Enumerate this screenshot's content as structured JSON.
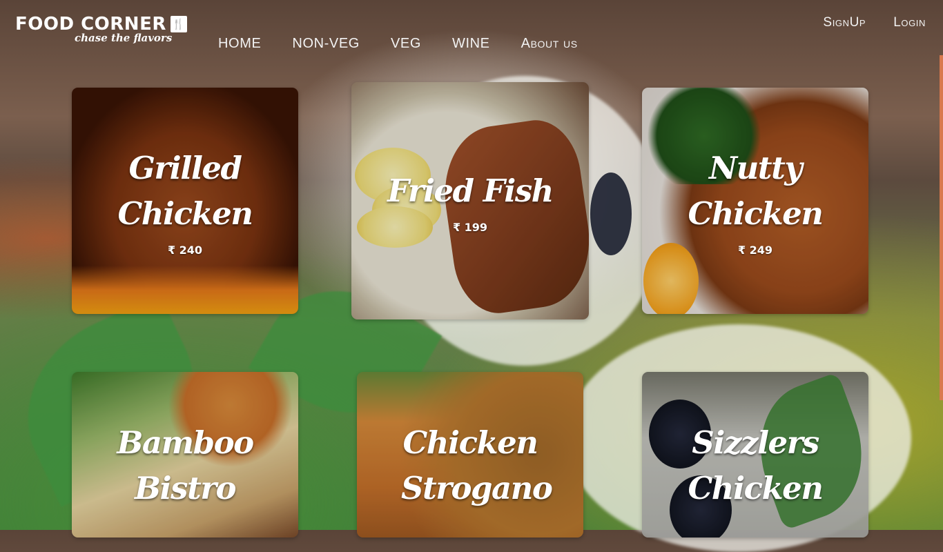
{
  "brand": {
    "name": "FOOD CORNER",
    "badge": "🍴",
    "tagline": "chase the flavors"
  },
  "nav": {
    "items": [
      {
        "label": "HOME"
      },
      {
        "label": "NON-VEG"
      },
      {
        "label": "VEG"
      },
      {
        "label": "WINE"
      },
      {
        "label": "About us"
      }
    ]
  },
  "auth": {
    "signup": "SignUp",
    "login": "Login"
  },
  "dishes": [
    {
      "name": "Grilled Chicken",
      "price": "₹ 240"
    },
    {
      "name": "Fried Fish",
      "price": "₹ 199"
    },
    {
      "name": "Nutty Chicken",
      "price": "₹ 249"
    },
    {
      "name": "Bamboo Bistro",
      "price": ""
    },
    {
      "name": "Chicken Strogano",
      "price": ""
    },
    {
      "name": "Sizzlers Chicken",
      "price": ""
    }
  ],
  "colors": {
    "accent": "#d9794e",
    "text": "#ffffff"
  }
}
